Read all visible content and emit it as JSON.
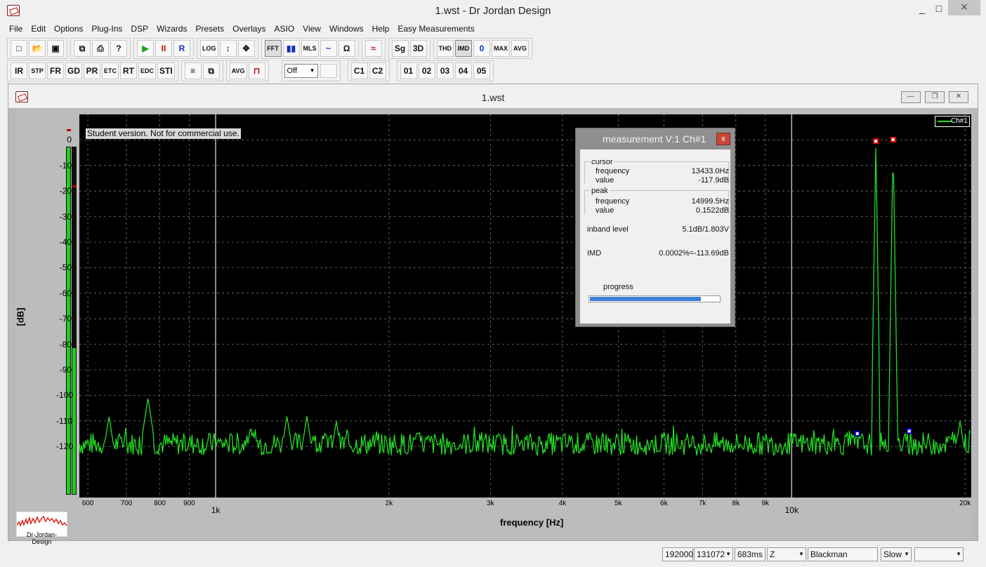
{
  "window": {
    "title": "1.wst - Dr Jordan Design",
    "min": "_",
    "max": "□",
    "close": "×"
  },
  "menu": [
    "File",
    "Edit",
    "Options",
    "Plug-Ins",
    "DSP",
    "Wizards",
    "Presets",
    "Overlays",
    "ASIO",
    "View",
    "Windows",
    "Help",
    "Easy Measurements"
  ],
  "toolbar1": {
    "file_group": [
      "new",
      "open",
      "save"
    ],
    "print_group": [
      "copy",
      "print",
      "help"
    ],
    "transport": [
      "▶",
      "II",
      "R"
    ],
    "tools": [
      "LOG",
      "↕",
      "✥"
    ],
    "analysis": [
      "FFT",
      "bars",
      "MLS",
      "~"
    ],
    "omega": "Ω",
    "sg": "Sg",
    "d3": "3D",
    "modes": [
      "THD",
      "IMD",
      "0",
      "MAX",
      "AVG"
    ]
  },
  "toolbar2": {
    "buttons": [
      "IR",
      "STP",
      "FR",
      "GD",
      "PR",
      "ETC",
      "RT",
      "EDC",
      "STI"
    ],
    "avg": "AVG",
    "combo_value": "Off",
    "channels": [
      "C1",
      "C2"
    ],
    "overlays": [
      "01",
      "02",
      "03",
      "04",
      "05"
    ]
  },
  "child": {
    "title": "1.wst"
  },
  "student_notice": "Student version. Not for commercial use.",
  "legend_label": "Ch#1",
  "ylabel": "[dB]",
  "xlabel": "frequency [Hz]",
  "logo_text": "Dr-Jordan-Design",
  "colors": {
    "trace": "#22dd22",
    "background": "#000000",
    "grid": "#777777"
  },
  "chart_data": {
    "type": "line",
    "xscale": "log",
    "xlim": [
      580,
      20500
    ],
    "ylim": [
      -140,
      10
    ],
    "ylabel": "[dB]",
    "xlabel": "frequency [Hz]",
    "yticks": [
      0,
      -10,
      -20,
      -30,
      -40,
      -50,
      -60,
      -70,
      -80,
      -90,
      -100,
      -110,
      -120
    ],
    "xticks": [
      {
        "v": 600,
        "label": "600",
        "major": false
      },
      {
        "v": 700,
        "label": "700",
        "major": false
      },
      {
        "v": 800,
        "label": "800",
        "major": false
      },
      {
        "v": 900,
        "label": "900",
        "major": false
      },
      {
        "v": 1000,
        "label": "1k",
        "major": true
      },
      {
        "v": 2000,
        "label": "2k",
        "major": false
      },
      {
        "v": 3000,
        "label": "3k",
        "major": false
      },
      {
        "v": 4000,
        "label": "4k",
        "major": false
      },
      {
        "v": 5000,
        "label": "5k",
        "major": false
      },
      {
        "v": 6000,
        "label": "6k",
        "major": false
      },
      {
        "v": 7000,
        "label": "7k",
        "major": false
      },
      {
        "v": 8000,
        "label": "8k",
        "major": false
      },
      {
        "v": 9000,
        "label": "9k",
        "major": false
      },
      {
        "v": 10000,
        "label": "10k",
        "major": true
      },
      {
        "v": 20000,
        "label": "20k",
        "major": false
      }
    ],
    "grid": true,
    "legend": "top-right",
    "series": [
      {
        "name": "Ch#1",
        "noise_floor": -119,
        "peaks": [
          {
            "x": 653,
            "y": -108
          },
          {
            "x": 763,
            "y": -101
          },
          {
            "x": 1000,
            "y": -118
          },
          {
            "x": 1150,
            "y": -112
          },
          {
            "x": 1330,
            "y": -108
          },
          {
            "x": 1440,
            "y": -108
          },
          {
            "x": 1620,
            "y": -110
          },
          {
            "x": 14000,
            "y": -0.5
          },
          {
            "x": 15000,
            "y": 0.15
          },
          {
            "x": 19600,
            "y": -110
          }
        ]
      }
    ],
    "markers": [
      {
        "x": 14000,
        "y": -0.5,
        "color": "red"
      },
      {
        "x": 15000,
        "y": 0.15,
        "color": "red"
      },
      {
        "x": 13000,
        "y": -115,
        "color": "blue"
      },
      {
        "x": 16000,
        "y": -114,
        "color": "blue"
      }
    ]
  },
  "dialog": {
    "title": "measurement V:1 Ch#1",
    "close": "x",
    "cursor_label": "cursor",
    "cursor_freq_label": "frequency",
    "cursor_freq": "13433.0Hz",
    "cursor_value_label": "value",
    "cursor_value": "-117.9dB",
    "peak_label": "peak",
    "peak_freq_label": "frequency",
    "peak_freq": "14999.5Hz",
    "peak_value_label": "value",
    "peak_value": "0.1522dB",
    "inband_label": "inband level",
    "inband_value": "5.1dB/1.803V",
    "imd_label": "IMD",
    "imd_value": "0.0002%=-113.69dB",
    "progress_label": "progress",
    "progress": 0.85
  },
  "status": {
    "rate": "192000",
    "fft_size": "131072",
    "duration": "683ms",
    "z": "Z",
    "window": "Blackman",
    "speed": "Slow",
    "extra": ""
  }
}
